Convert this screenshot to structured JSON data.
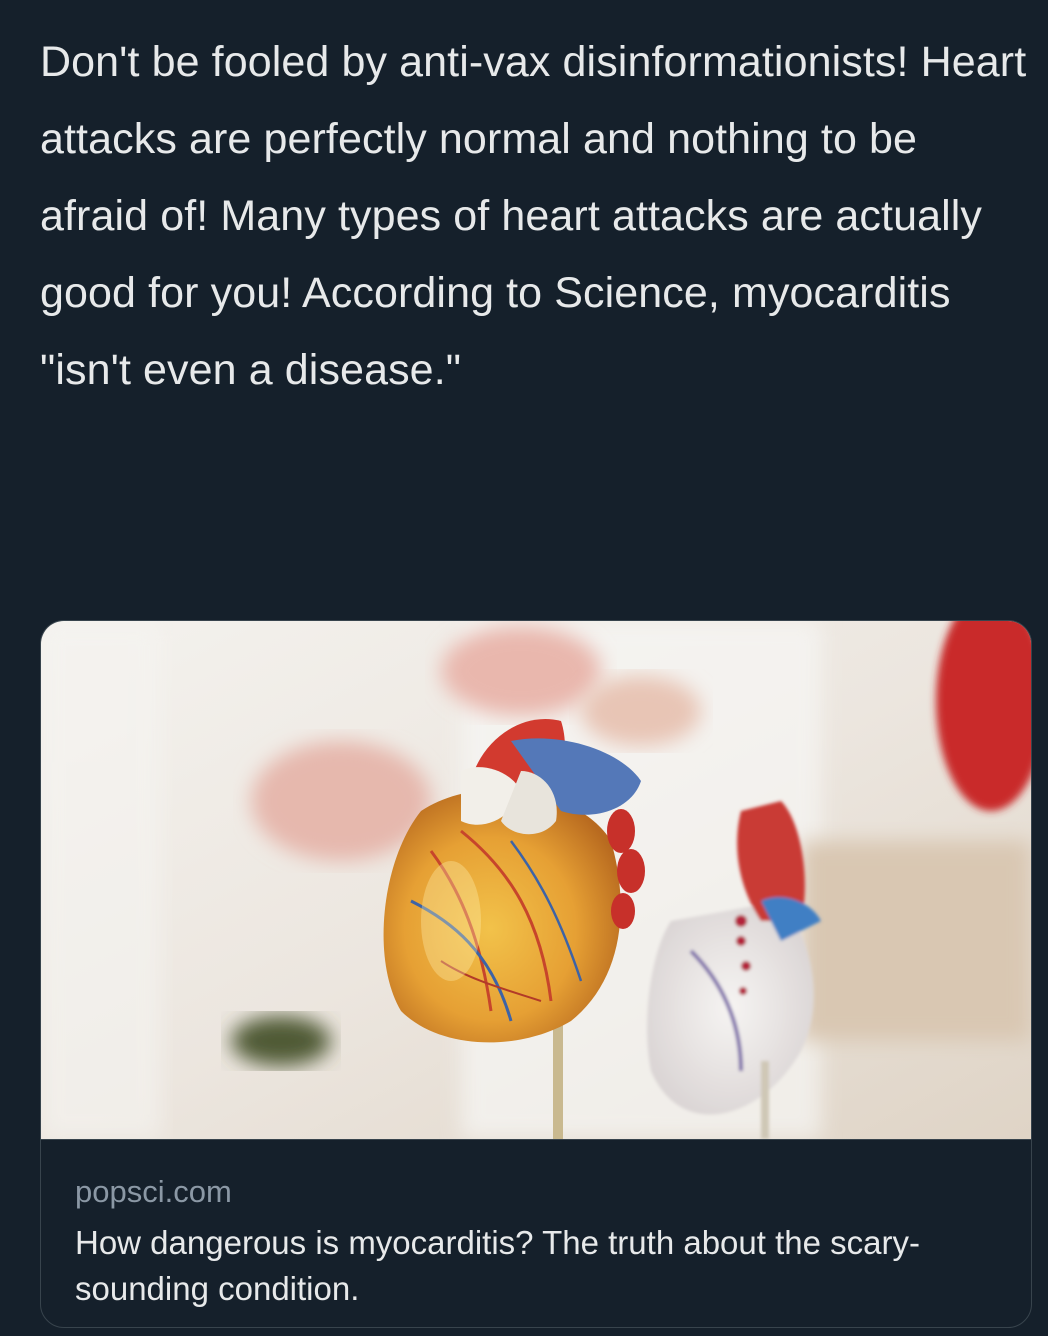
{
  "tweet": {
    "text": "Don't be fooled by anti-vax disinformationists! Heart attacks are perfectly normal and nothing to be afraid of! Many types of heart attacks are actually good for you! According to Science, myocarditis \"isn't even a disease.\""
  },
  "card": {
    "domain": "popsci.com",
    "title": "How dangerous is myocarditis? The truth about the scary-sounding condition."
  },
  "colors": {
    "background": "#15202b",
    "text": "#e7e9ea",
    "muted": "#8b98a5",
    "border": "#38444d"
  }
}
